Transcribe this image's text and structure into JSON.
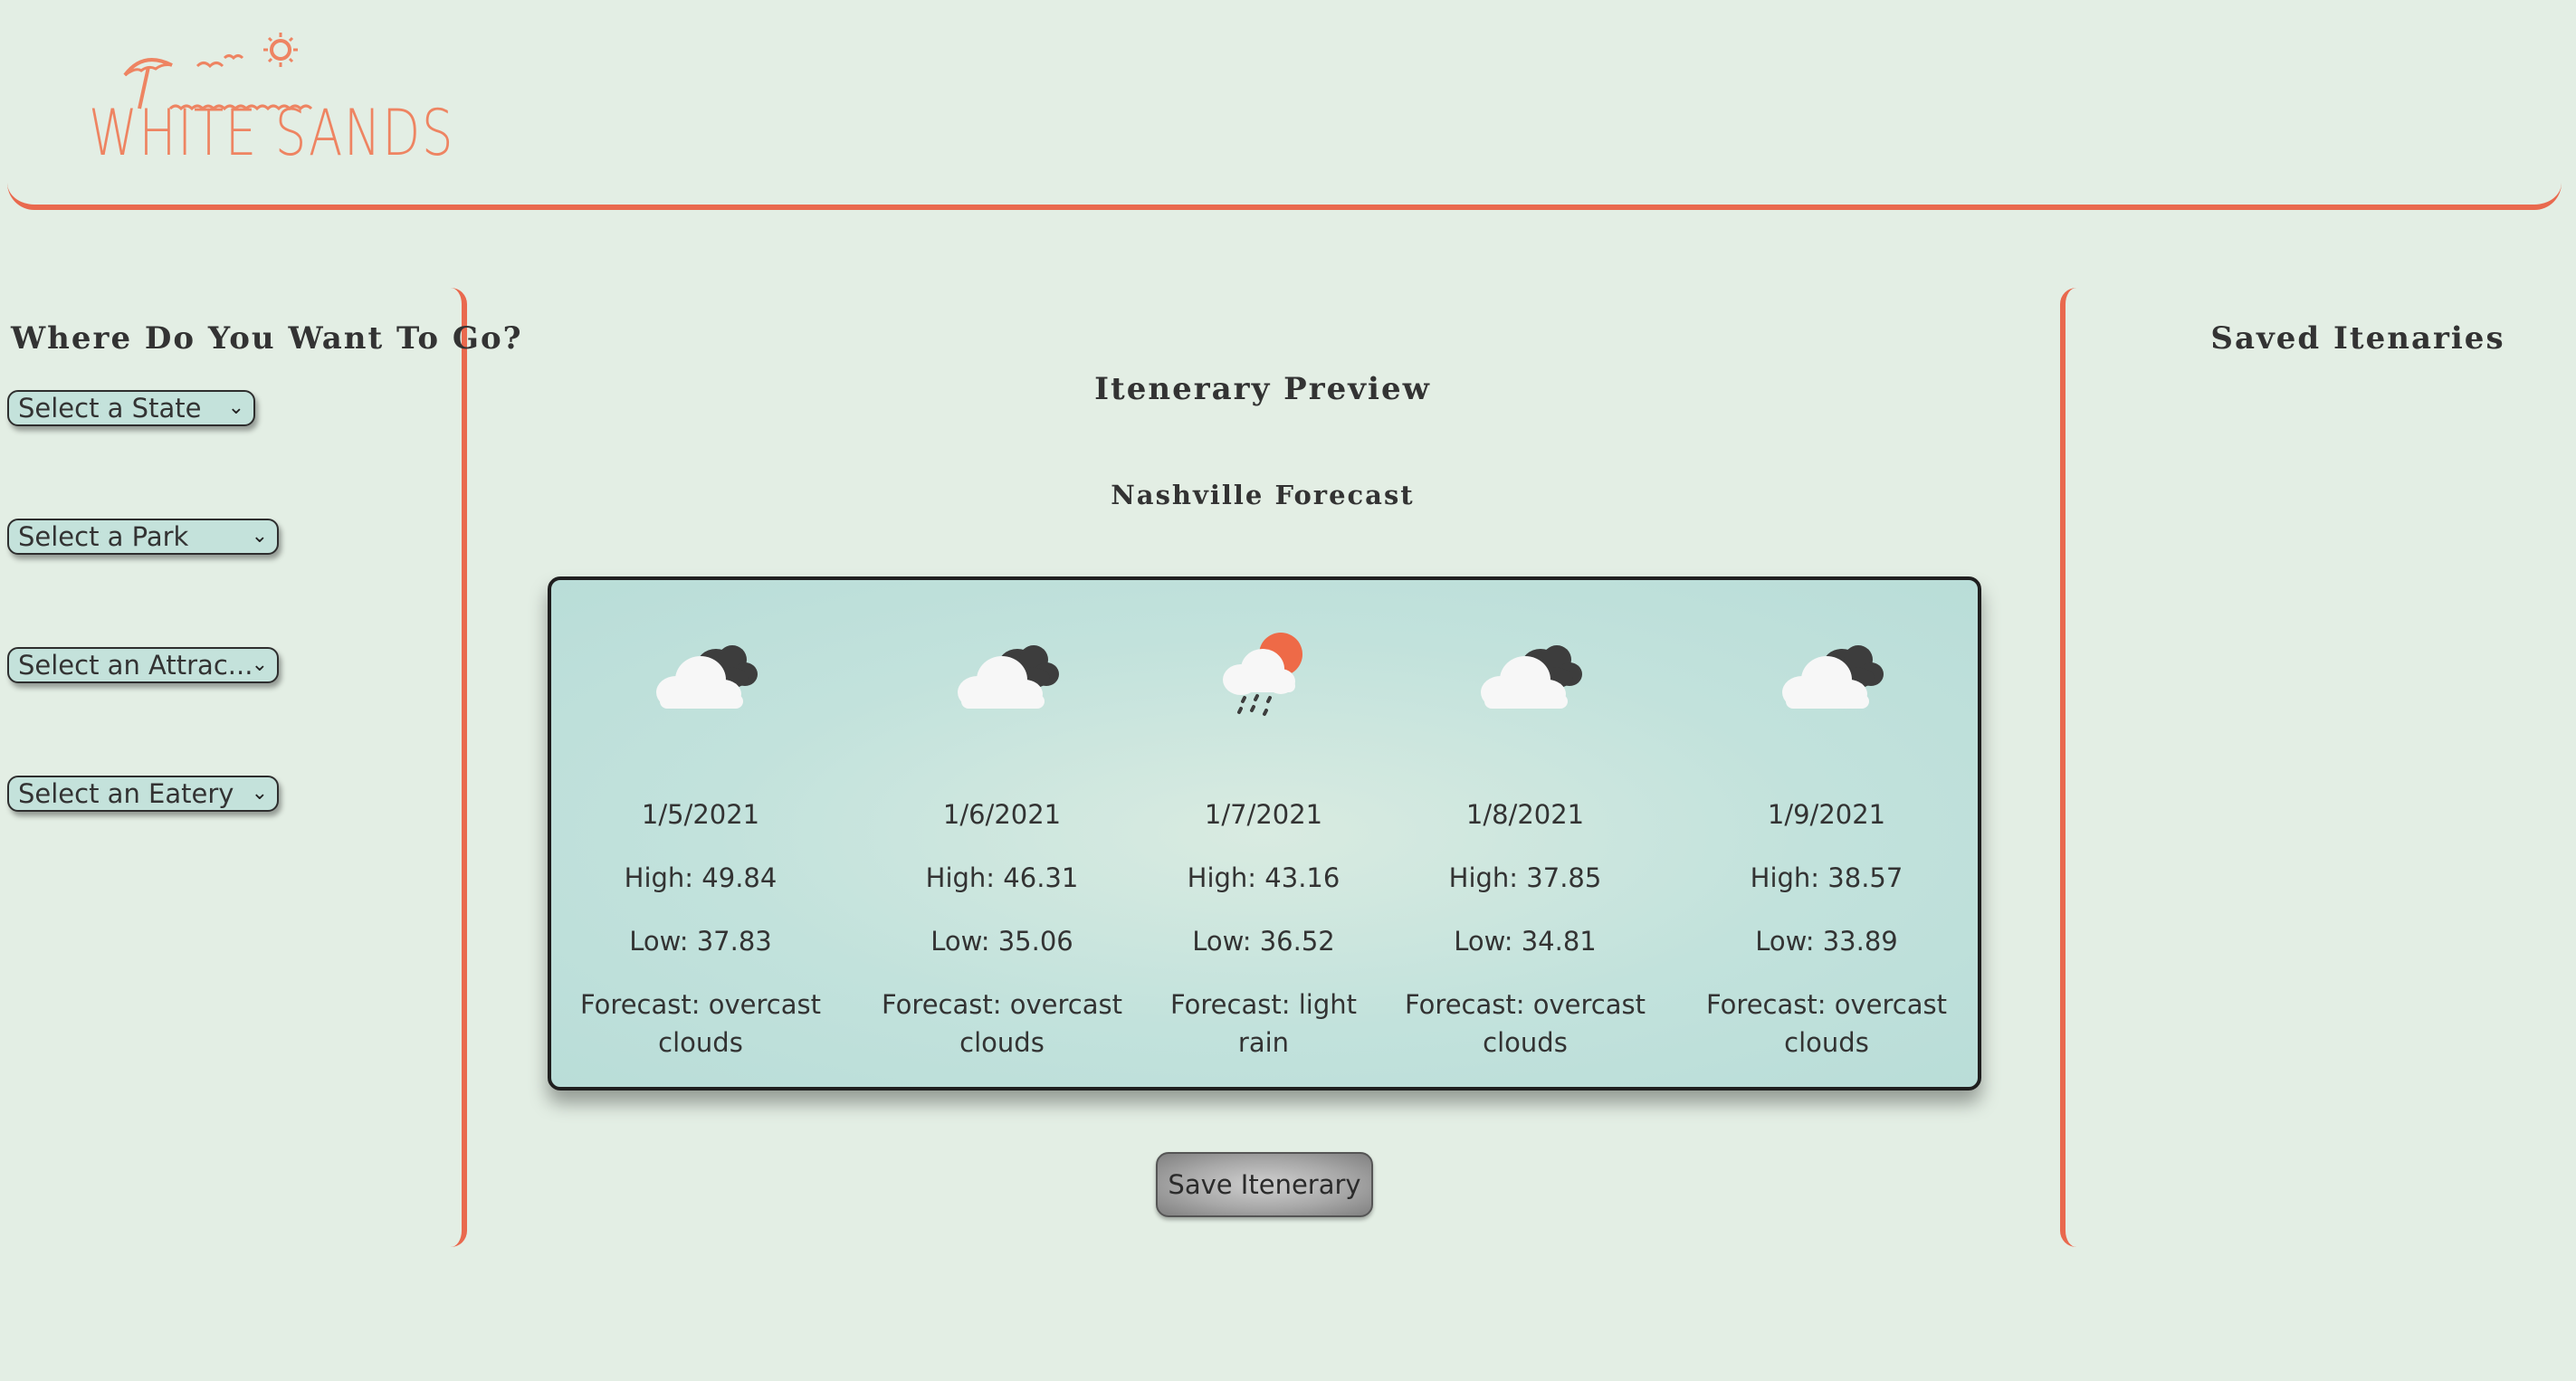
{
  "brand": {
    "logo_text": "WHITE SANDS",
    "accent": "#e9694e"
  },
  "sidebar": {
    "title": "Where Do You Want To Go?",
    "selects": [
      {
        "label": "Select a State"
      },
      {
        "label": "Select a Park"
      },
      {
        "label": "Select an Attrac..."
      },
      {
        "label": "Select an Eatery"
      }
    ]
  },
  "preview": {
    "title": "Itenerary Preview",
    "forecast_title": "Nashville Forecast",
    "days": [
      {
        "date": "1/5/2021",
        "high": "High: 49.84",
        "low": "Low: 37.83",
        "forecast_line1": "Forecast: overcast",
        "forecast_line2": "clouds",
        "icon": "overcast-clouds-icon"
      },
      {
        "date": "1/6/2021",
        "high": "High: 46.31",
        "low": "Low: 35.06",
        "forecast_line1": "Forecast: overcast",
        "forecast_line2": "clouds",
        "icon": "overcast-clouds-icon"
      },
      {
        "date": "1/7/2021",
        "high": "High: 43.16",
        "low": "Low: 36.52",
        "forecast_line1": "Forecast: light",
        "forecast_line2": "rain",
        "icon": "light-rain-icon"
      },
      {
        "date": "1/8/2021",
        "high": "High: 37.85",
        "low": "Low: 34.81",
        "forecast_line1": "Forecast: overcast",
        "forecast_line2": "clouds",
        "icon": "overcast-clouds-icon"
      },
      {
        "date": "1/9/2021",
        "high": "High: 38.57",
        "low": "Low: 33.89",
        "forecast_line1": "Forecast: overcast",
        "forecast_line2": "clouds",
        "icon": "overcast-clouds-icon"
      }
    ],
    "save_label": "Save Itenerary"
  },
  "saved": {
    "title": "Saved Itenaries"
  }
}
